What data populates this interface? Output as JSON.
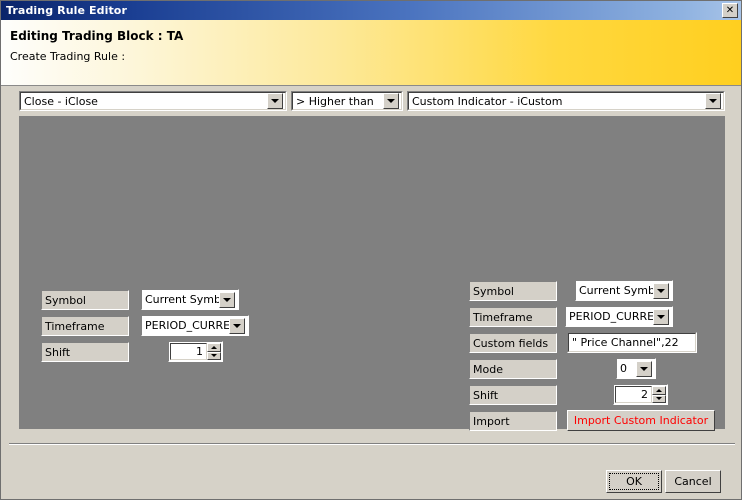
{
  "window": {
    "title": "Trading Rule Editor",
    "close_label": "✕"
  },
  "header": {
    "title": "Editing Trading Block : TA",
    "subtitle": "Create Trading Rule :"
  },
  "rule_row": {
    "left_operand": "Close - iClose",
    "operator": "> Higher than",
    "right_operand": "Custom Indicator - iCustom"
  },
  "left_panel": {
    "rows": [
      {
        "label": "Symbol",
        "value": "Current Symbol"
      },
      {
        "label": "Timeframe",
        "value": "PERIOD_CURRENT"
      },
      {
        "label": "Shift",
        "value": "1"
      }
    ]
  },
  "right_panel": {
    "rows": [
      {
        "label": "Symbol",
        "value": "Current Symbol"
      },
      {
        "label": "Timeframe",
        "value": "PERIOD_CURRENT"
      },
      {
        "label": "Custom fields",
        "value": "\" Price Channel\",22"
      },
      {
        "label": "Mode",
        "value": "0"
      },
      {
        "label": "Shift",
        "value": "2"
      },
      {
        "label": "Import",
        "value": "Import Custom Indicator"
      }
    ]
  },
  "footer": {
    "ok_label": "OK",
    "cancel_label": "Cancel"
  },
  "colors": {
    "titlebar_start": "#0a246a",
    "titlebar_end": "#a8c4e8",
    "header_start": "#fefefc",
    "header_end": "#ffcf1f",
    "panel_bg": "#808080",
    "dialog_bg": "#d6d2c8",
    "control_face": "#d4d0c8",
    "import_text": "#ff0000"
  }
}
